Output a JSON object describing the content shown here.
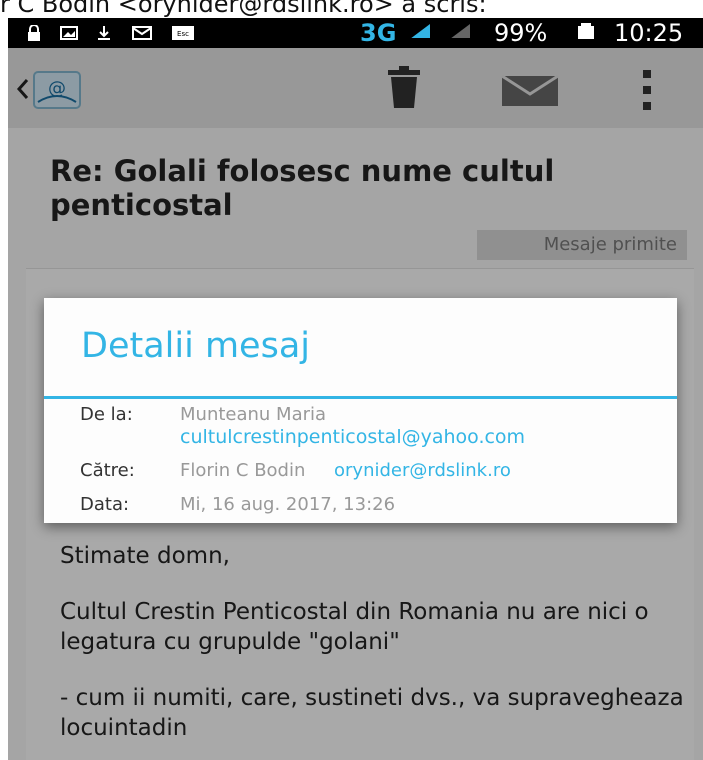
{
  "page_top_text": "r C Bodin <orynider@rdslink.ro> a scris:",
  "status_bar": {
    "network": "3G",
    "battery": "99%",
    "time": "10:25",
    "icons": [
      "lock-icon",
      "image-icon",
      "download-icon",
      "mail-icon",
      "esc-icon",
      "signal-icon",
      "battery-icon"
    ]
  },
  "action_bar": {
    "icons": [
      "back-chevron-icon",
      "app-mail-icon",
      "trash-icon",
      "envelope-icon",
      "overflow-menu-icon"
    ]
  },
  "email": {
    "subject": "Re: Golali folosesc nume cultul penticostal",
    "folder": "Mesaje primite",
    "sender_partial": "M",
    "body": [
      "Stimate domn,",
      "Cultul Crestin Penticostal din Romania nu are nici o legatura cu grupulde \"golani\"",
      " - cum ii numiti, care, sustineti dvs., va supravegheaza locuintadin"
    ]
  },
  "dialog": {
    "title": "Detalii mesaj",
    "rows": [
      {
        "label": "De la:",
        "name": "Munteanu Maria",
        "email": "cultulcrestinpenticostal@yahoo.com"
      },
      {
        "label": "Către:",
        "name": "Florin C Bodin",
        "email": "orynider@rdslink.ro"
      },
      {
        "label": "Data:",
        "value": "Mi, 16 aug. 2017, 13:26"
      }
    ]
  },
  "colors": {
    "accent": "#33b5e5",
    "status_bar_bg": "#000000",
    "action_bar_bg": "#e0e0e0"
  }
}
